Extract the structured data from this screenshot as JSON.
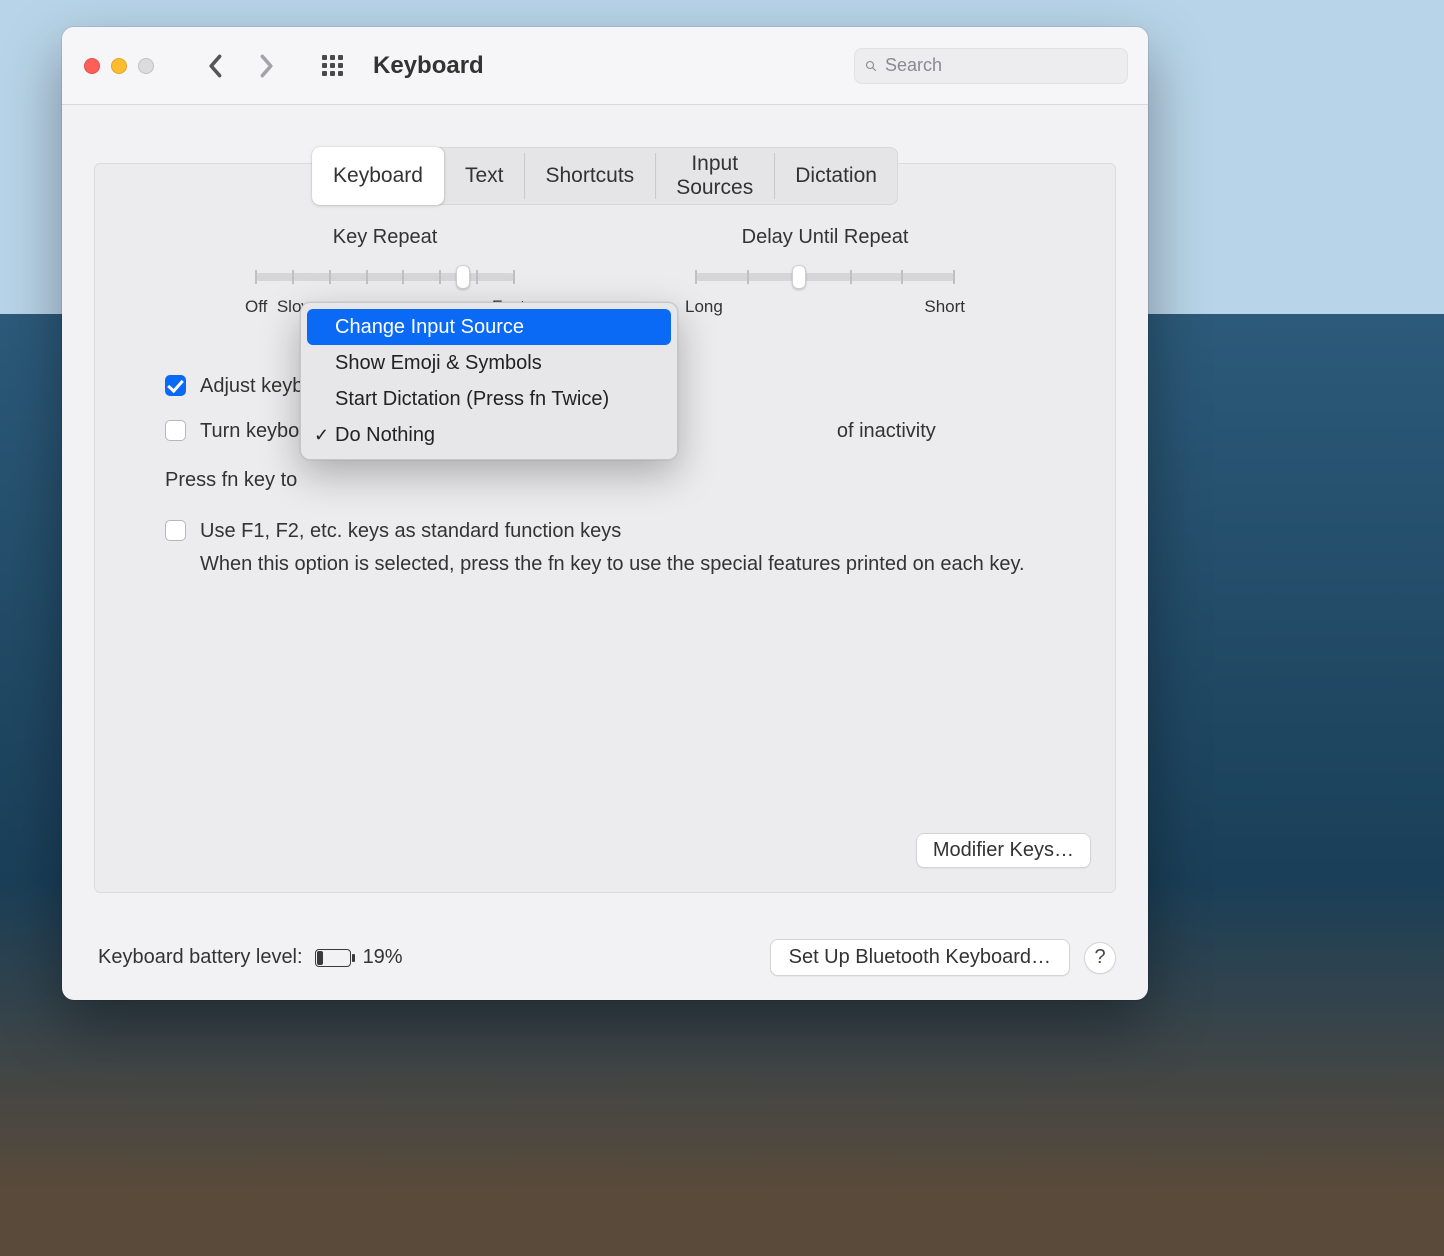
{
  "window": {
    "title": "Keyboard",
    "search_placeholder": "Search"
  },
  "tabs": [
    {
      "label": "Keyboard",
      "active": true
    },
    {
      "label": "Text",
      "active": false
    },
    {
      "label": "Shortcuts",
      "active": false
    },
    {
      "label": "Input Sources",
      "active": false
    },
    {
      "label": "Dictation",
      "active": false
    }
  ],
  "sliders": {
    "key_repeat": {
      "title": "Key Repeat",
      "left_label": "Off",
      "left_label2": "Slow",
      "right_label": "Fast",
      "ticks": 8,
      "value_pct": 80
    },
    "delay": {
      "title": "Delay Until Repeat",
      "left_label": "Long",
      "right_label": "Short",
      "ticks": 6,
      "value_pct": 40
    }
  },
  "options": {
    "adjust_brightness": {
      "label": "Adjust keyboard brightness in low light",
      "checked": true
    },
    "turn_off_backlight": {
      "label": "Turn keyboard backlight off after",
      "trailing": "of inactivity",
      "checked": false
    },
    "fn_label": "Press fn key to",
    "function_keys": {
      "label": "Use F1, F2, etc. keys as standard function keys",
      "hint": "When this option is selected, press the fn key to use the special features printed on each key.",
      "checked": false
    }
  },
  "fn_menu": {
    "items": [
      {
        "label": "Change Input Source",
        "highlighted": true,
        "checked": false
      },
      {
        "label": "Show Emoji & Symbols",
        "highlighted": false,
        "checked": false
      },
      {
        "label": "Start Dictation (Press fn Twice)",
        "highlighted": false,
        "checked": false
      },
      {
        "label": "Do Nothing",
        "highlighted": false,
        "checked": true
      }
    ]
  },
  "buttons": {
    "modifier": "Modifier Keys…",
    "bluetooth": "Set Up Bluetooth Keyboard…",
    "help": "?"
  },
  "footer": {
    "battery_label": "Keyboard battery level:",
    "battery_pct_text": "19%",
    "battery_pct": 19
  }
}
